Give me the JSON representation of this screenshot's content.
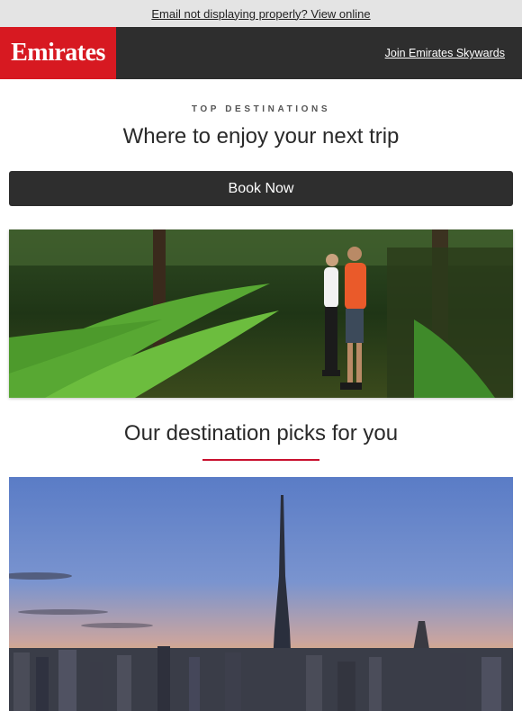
{
  "topbar": {
    "view_online": "Email not displaying properly? View online"
  },
  "header": {
    "logo_text": "Emirates",
    "join_link": "Join Emirates Skywards"
  },
  "intro": {
    "eyebrow": "TOP DESTINATIONS",
    "headline": "Where to enjoy your next trip",
    "cta": "Book Now"
  },
  "images": {
    "hero1": "forest-hikers-photo",
    "hero2": "dubai-skyline-photo"
  },
  "picks": {
    "headline": "Our destination picks for you"
  },
  "colors": {
    "brand_red": "#d71921",
    "dark": "#2e2e2e",
    "divider": "#c8102e"
  }
}
